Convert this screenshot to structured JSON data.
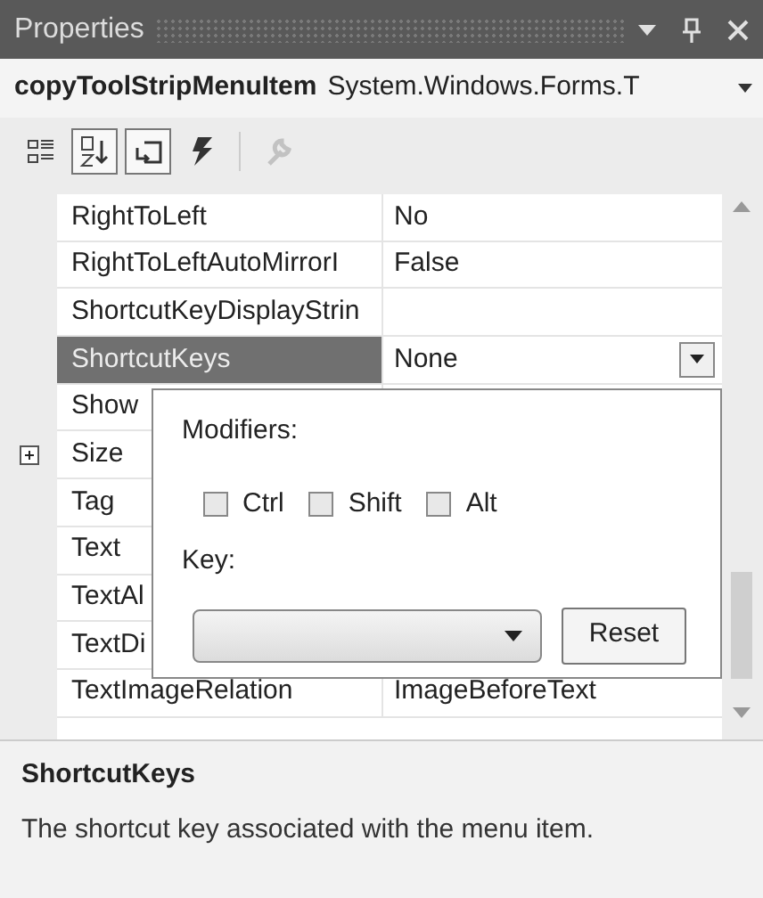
{
  "window": {
    "title": "Properties"
  },
  "object_selector": {
    "name": "copyToolStripMenuItem",
    "type": "System.Windows.Forms.T"
  },
  "toolbar": [
    {
      "kind": "categorized",
      "selected": false,
      "disabled": false
    },
    {
      "kind": "alphabetical",
      "selected": true,
      "disabled": false
    },
    {
      "kind": "properties",
      "selected": true,
      "disabled": false
    },
    {
      "kind": "events",
      "selected": false,
      "disabled": false
    },
    {
      "kind": "pages",
      "selected": false,
      "disabled": true
    }
  ],
  "properties": [
    {
      "name": "RightToLeft",
      "value": "No",
      "selected": false,
      "expandable": false
    },
    {
      "name": "RightToLeftAutoMirrorI",
      "value": "False",
      "selected": false,
      "expandable": false
    },
    {
      "name": "ShortcutKeyDisplayStrin",
      "selected": false,
      "expandable": false
    },
    {
      "name": "ShortcutKeys",
      "value": "None",
      "selected": true,
      "expandable": false
    },
    {
      "name": "Show",
      "selected": false,
      "expandable": false
    },
    {
      "name": "Size",
      "selected": false,
      "expandable": true
    },
    {
      "name": "Tag",
      "selected": false,
      "expandable": false
    },
    {
      "name": "Text",
      "selected": false,
      "expandable": false
    },
    {
      "name": "TextAl",
      "selected": false,
      "expandable": false
    },
    {
      "name": "TextDi",
      "selected": false,
      "expandable": false
    },
    {
      "name": "TextImageRelation",
      "value": "ImageBeforeText",
      "selected": false,
      "expandable": false
    }
  ],
  "editor_popup": {
    "modifiers_label": "Modifiers:",
    "modifiers": [
      {
        "label": "Ctrl",
        "checked": false
      },
      {
        "label": "Shift",
        "checked": false
      },
      {
        "label": "Alt",
        "checked": false
      }
    ],
    "key_label": "Key:",
    "reset_button": "Reset"
  },
  "description": {
    "title": "ShortcutKeys",
    "text": "The shortcut key associated with the menu item."
  }
}
